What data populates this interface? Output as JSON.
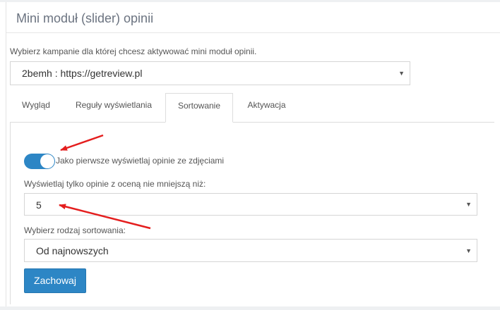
{
  "panel": {
    "title": "Mini moduł (slider) opinii"
  },
  "campaign": {
    "label": "Wybierz kampanie dla której chcesz aktywować mini moduł opinii.",
    "selected": "2bemh : https://getreview.pl"
  },
  "tabs": [
    {
      "label": "Wygląd"
    },
    {
      "label": "Reguły wyświetlania"
    },
    {
      "label": "Sortowanie",
      "active": true
    },
    {
      "label": "Aktywacja"
    }
  ],
  "sorting": {
    "photo_toggle_label": "Jako pierwsze wyświetlaj opinie ze zdjęciami",
    "photo_toggle_on": true,
    "min_rating_label": "Wyświetlaj tylko opinie z oceną nie mniejszą niż:",
    "min_rating_value": "5",
    "sort_label": "Wybierz rodzaj sortowania:",
    "sort_value": "Od najnowszych"
  },
  "save_button": "Zachowaj",
  "icons": {
    "dropdown": "caret-down-icon",
    "annotation": "red-arrow-icon"
  },
  "colors": {
    "accent": "#2d86c5",
    "annotation": "#e41e1e",
    "title": "#6b7380"
  }
}
